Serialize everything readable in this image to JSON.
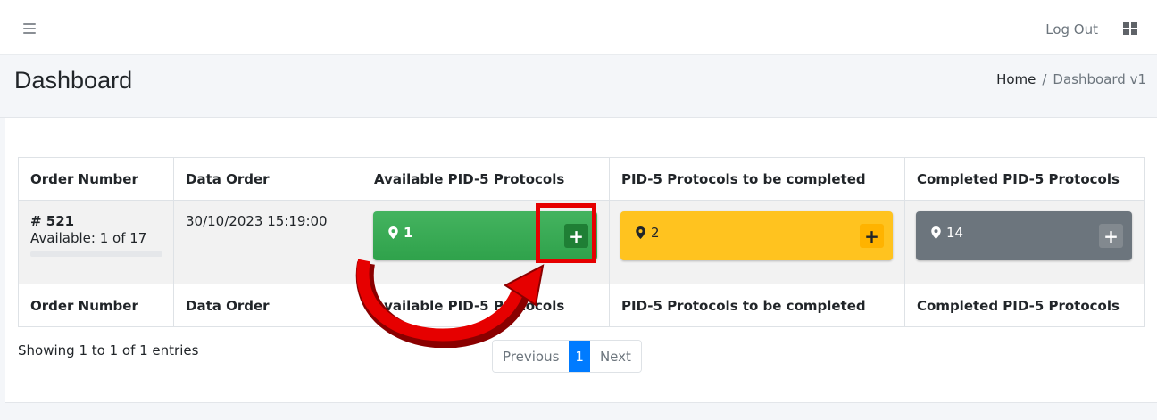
{
  "navbar": {
    "logout_label": "Log Out",
    "icons": [
      "hamburger-icon",
      "apps-grid-icon"
    ]
  },
  "header": {
    "title": "Dashboard",
    "breadcrumb": {
      "home": "Home",
      "separator": "/",
      "current": "Dashboard v1"
    }
  },
  "table": {
    "columns": [
      "Order Number",
      "Data Order",
      "Available PID-5 Protocols",
      "PID-5 Protocols to be completed",
      "Completed PID-5 Protocols"
    ],
    "rows": [
      {
        "order_number": "# 521",
        "availability": "Available: 1 of 17",
        "availability_fraction": 0.06,
        "date": "30/10/2023 15:19:00",
        "available_count": "1",
        "to_complete_count": "2",
        "completed_count": "14",
        "plus_label": "+"
      }
    ]
  },
  "entries_info": "Showing 1 to 1 of 1 entries",
  "pagination": {
    "previous": "Previous",
    "current": "1",
    "next": "Next"
  },
  "colors": {
    "available": "#3aab55",
    "to_complete": "#ffc31f",
    "completed": "#6c757d",
    "pagination_active": "#007bff",
    "annotation": "#e60000"
  },
  "annotation": {
    "type": "highlight-and-arrow",
    "target": "available-plus-button"
  }
}
